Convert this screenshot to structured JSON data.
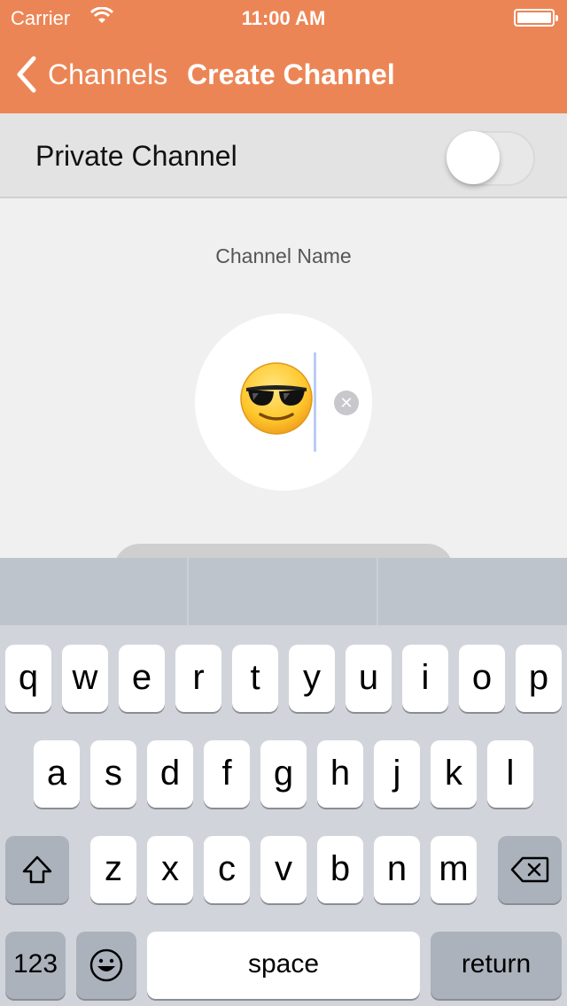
{
  "status": {
    "carrier": "Carrier",
    "time": "11:00 AM"
  },
  "nav": {
    "back_label": "Channels",
    "title": "Create Channel"
  },
  "settings": {
    "private_label": "Private Channel",
    "private_on": false
  },
  "channel": {
    "caption": "Channel Name",
    "emoji": "😎"
  },
  "colors": {
    "nav_bg": "#ec8555",
    "keyboard_bg": "#d1d5db"
  },
  "keyboard": {
    "row1": [
      "q",
      "w",
      "e",
      "r",
      "t",
      "y",
      "u",
      "i",
      "o",
      "p"
    ],
    "row2": [
      "a",
      "s",
      "d",
      "f",
      "g",
      "h",
      "j",
      "k",
      "l"
    ],
    "row3": [
      "z",
      "x",
      "c",
      "v",
      "b",
      "n",
      "m"
    ],
    "numbers_label": "123",
    "space_label": "space",
    "return_label": "return"
  }
}
